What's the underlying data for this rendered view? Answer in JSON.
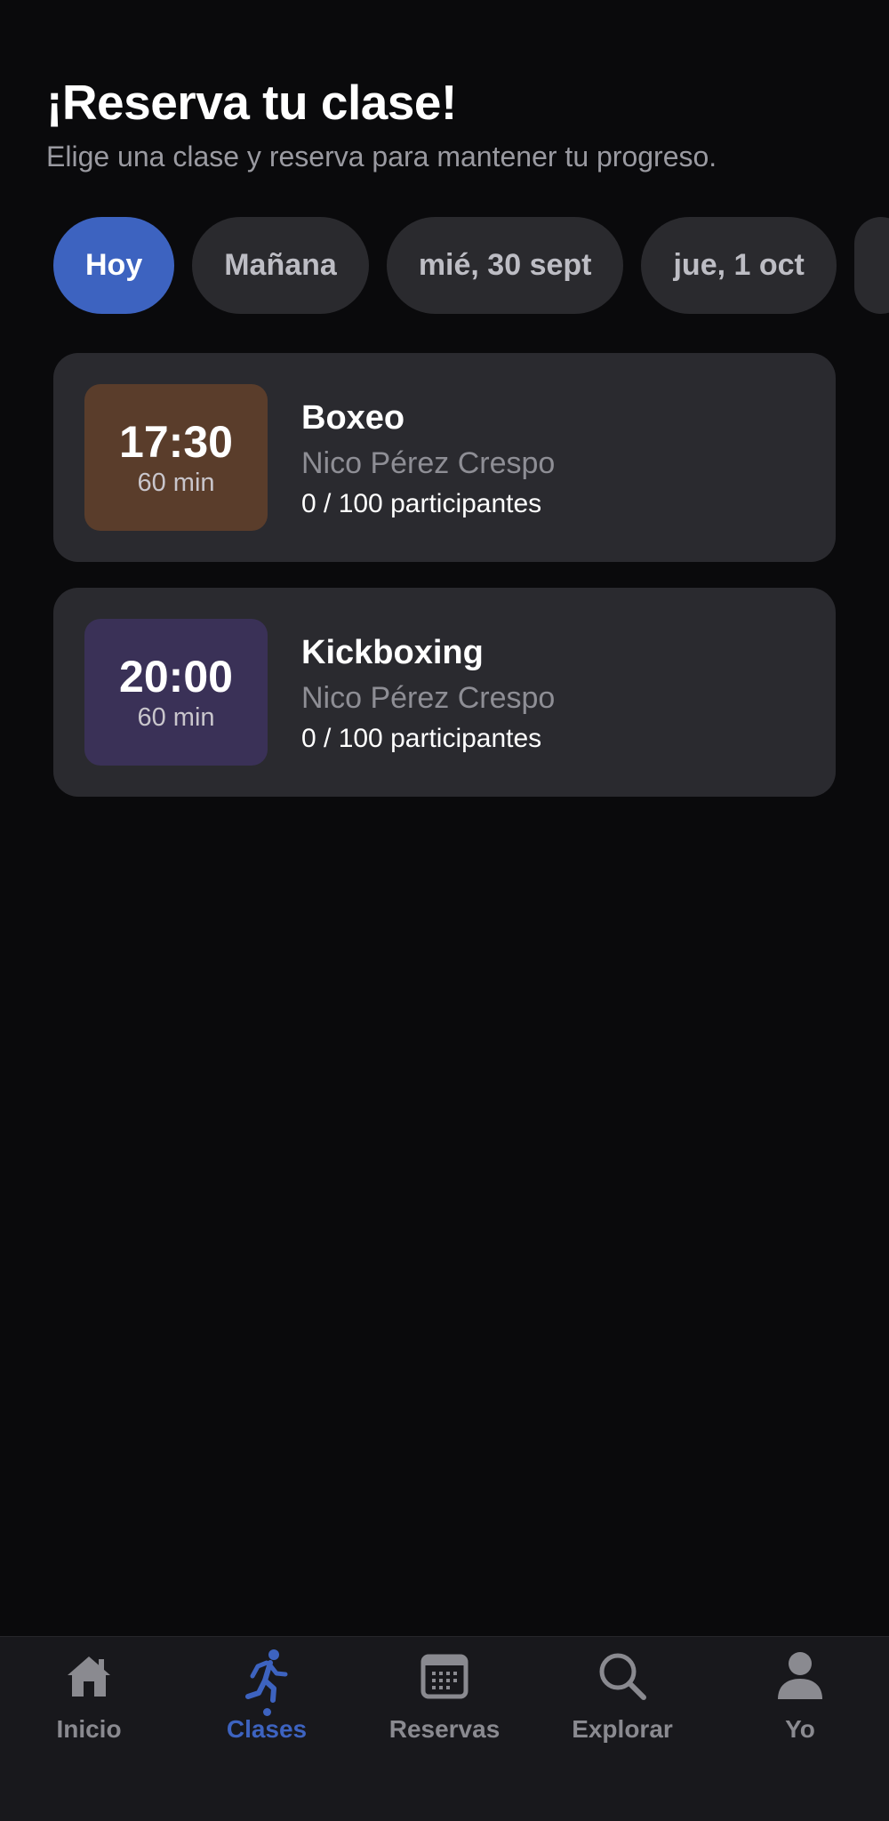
{
  "header": {
    "title": "¡Reserva tu clase!",
    "subtitle": "Elige una clase y reserva para mantener tu progreso."
  },
  "dates": [
    {
      "label": "Hoy",
      "active": true
    },
    {
      "label": "Mañana",
      "active": false
    },
    {
      "label": "mié, 30 sept",
      "active": false
    },
    {
      "label": "jue, 1 oct",
      "active": false
    }
  ],
  "classes": [
    {
      "time": "17:30",
      "duration": "60 min",
      "name": "Boxeo",
      "instructor": "Nico Pérez Crespo",
      "capacity": "0 / 100 participantes",
      "color": "#5a3d2b"
    },
    {
      "time": "20:00",
      "duration": "60 min",
      "name": "Kickboxing",
      "instructor": "Nico Pérez Crespo",
      "capacity": "0 / 100 participantes",
      "color": "#3a3157"
    }
  ],
  "tabs": [
    {
      "label": "Inicio",
      "icon": "home-icon",
      "active": false
    },
    {
      "label": "Clases",
      "icon": "running-person-icon",
      "active": true
    },
    {
      "label": "Reservas",
      "icon": "calendar-icon",
      "active": false
    },
    {
      "label": "Explorar",
      "icon": "search-icon",
      "active": false
    },
    {
      "label": "Yo",
      "icon": "person-icon",
      "active": false
    }
  ],
  "colors": {
    "accent": "#3d63c0",
    "background": "#0a0a0c",
    "card": "#2a2a2f"
  }
}
